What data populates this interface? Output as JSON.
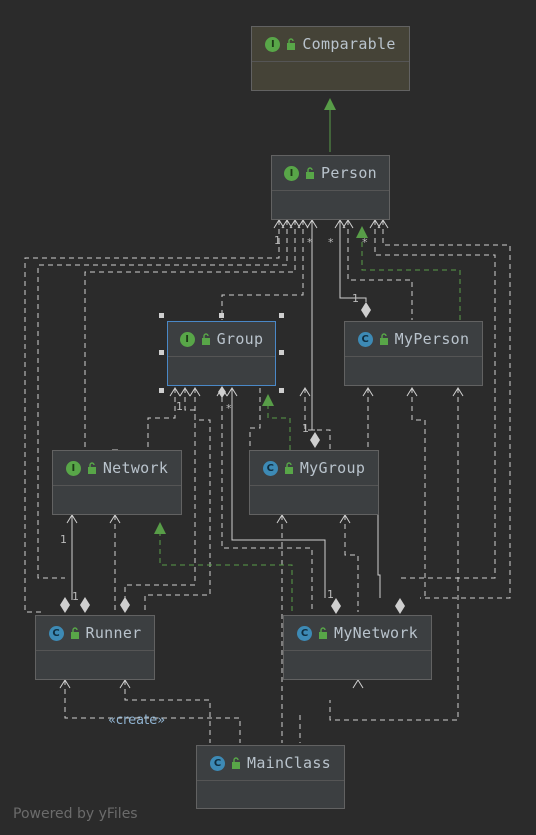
{
  "nodes": {
    "comparable": {
      "name": "Comparable",
      "kind": "I"
    },
    "person": {
      "name": "Person",
      "kind": "I"
    },
    "group": {
      "name": "Group",
      "kind": "I"
    },
    "myperson": {
      "name": "MyPerson",
      "kind": "C"
    },
    "network": {
      "name": "Network",
      "kind": "I"
    },
    "mygroup": {
      "name": "MyGroup",
      "kind": "C"
    },
    "runner": {
      "name": "Runner",
      "kind": "C"
    },
    "mynetwork": {
      "name": "MyNetwork",
      "kind": "C"
    },
    "mainclass": {
      "name": "MainClass",
      "kind": "C"
    }
  },
  "multiplicities": {
    "m1": "1",
    "m2": "*",
    "m3": "*",
    "m4": "*",
    "m5": "1",
    "m6": "1",
    "m7": "*",
    "m8": "1",
    "m9": "1",
    "m10": "1",
    "m11": "1"
  },
  "edge_labels": {
    "create": "«create»"
  },
  "footer": "Powered by yFiles",
  "colors": {
    "background": "#2b2b2b",
    "node_fill": "#3c3f41",
    "selected_border": "#4a88c7",
    "implements_arrow": "#589d48",
    "dependency_line": "#cfcfcf",
    "interface_badge": "#58a648",
    "class_badge": "#3d8ab5"
  }
}
